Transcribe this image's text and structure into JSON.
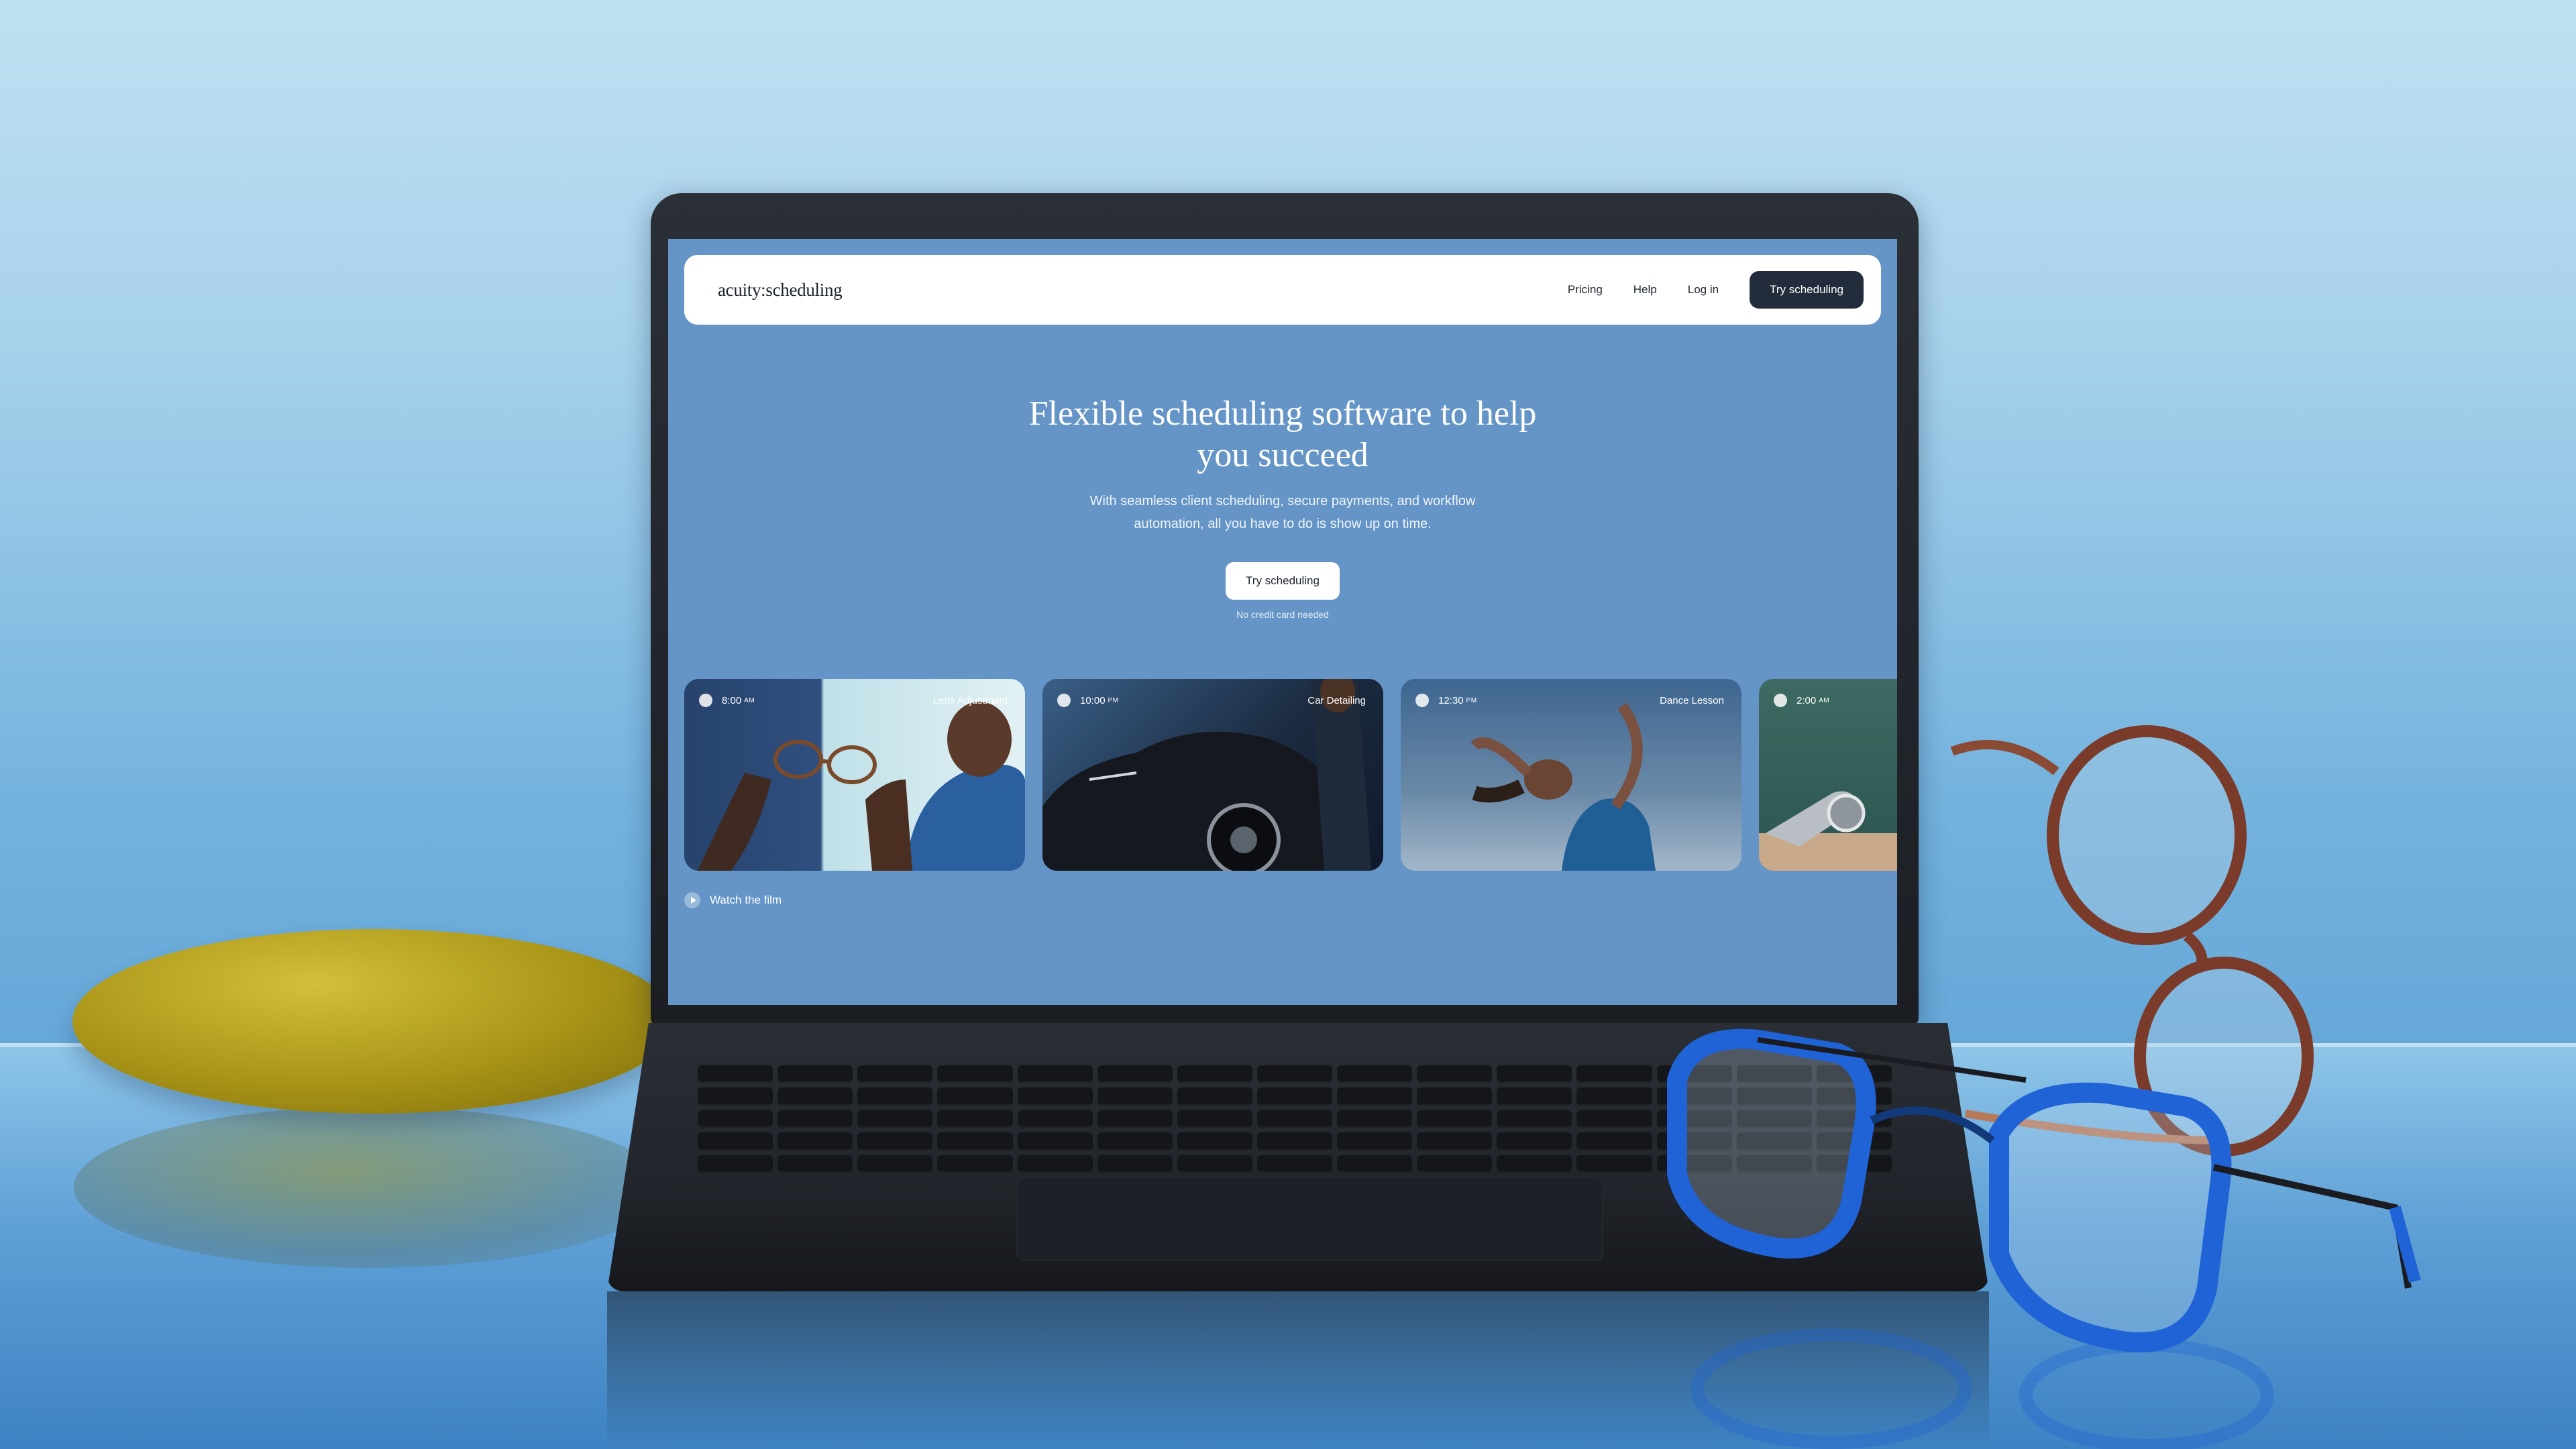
{
  "nav": {
    "logo": "acuity:scheduling",
    "links": [
      "Pricing",
      "Help",
      "Log in"
    ],
    "cta": "Try scheduling"
  },
  "hero": {
    "title": "Flexible scheduling software to help you succeed",
    "subtitle": "With seamless client scheduling, secure payments, and workflow automation, all you have to do is show up on time.",
    "cta": "Try scheduling",
    "note": "No credit card needed"
  },
  "cards": [
    {
      "time": "8:00",
      "ampm": "AM",
      "label": "Lens Adjustment"
    },
    {
      "time": "10:00",
      "ampm": "PM",
      "label": "Car Detailing"
    },
    {
      "time": "12:30",
      "ampm": "PM",
      "label": "Dance Lesson"
    },
    {
      "time": "2:00",
      "ampm": "AM",
      "label": ""
    }
  ],
  "watch": {
    "label": "Watch the film"
  },
  "colors": {
    "screen_bg": "#6495c6",
    "nav_cta_bg": "#222c3a",
    "card_white": "#ffffff"
  }
}
